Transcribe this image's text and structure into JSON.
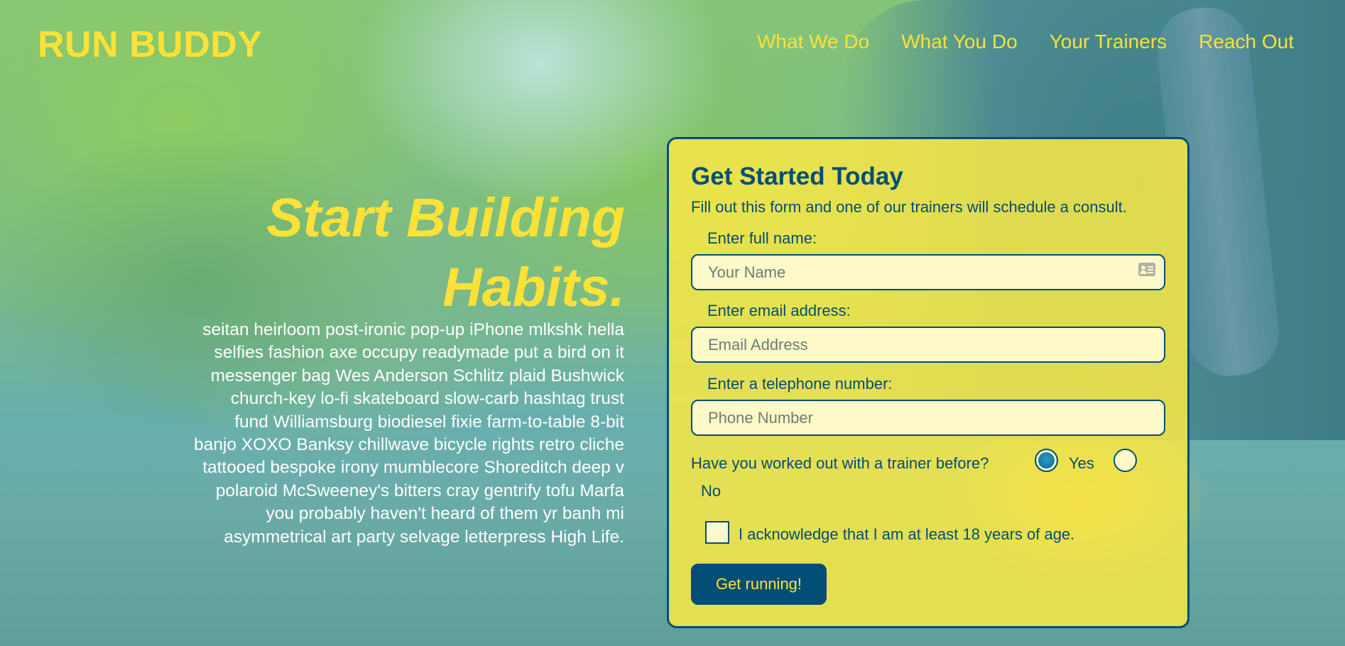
{
  "site": {
    "logo": "RUN BUDDY"
  },
  "nav": {
    "items": [
      "What We Do",
      "What You Do",
      "Your Trainers",
      "Reach Out"
    ]
  },
  "hero": {
    "title_line1": "Start Building",
    "title_line2": "Habits.",
    "body": "seitan heirloom post-ironic pop-up iPhone mlkshk hella selfies fashion axe occupy readymade put a bird on it messenger bag Wes Anderson Schlitz plaid Bushwick church-key lo-fi skateboard slow-carb hashtag trust fund Williamsburg biodiesel fixie farm-to-table 8-bit banjo XOXO Banksy chillwave bicycle rights retro cliche tattooed bespoke irony mumblecore Shoreditch deep v polaroid McSweeney's bitters cray gentrify tofu Marfa you probably haven't heard of them yr banh mi asymmetrical art party selvage letterpress High Life."
  },
  "form": {
    "title": "Get Started Today",
    "subtitle": "Fill out this form and one of our trainers will schedule a consult.",
    "name_label": "Enter full name:",
    "name_placeholder": "Your Name",
    "email_label": "Enter email address:",
    "email_placeholder": "Email Address",
    "phone_label": "Enter a telephone number:",
    "phone_placeholder": "Phone Number",
    "trainer_question": "Have you worked out with a trainer before?",
    "yes_label": "Yes",
    "no_label": "No",
    "trainer_selected": "Yes",
    "age_ack": "I acknowledge that I am at least 18 years of age.",
    "submit_label": "Get running!"
  },
  "colors": {
    "accent_yellow": "#fce138",
    "primary_blue": "#024e76"
  },
  "icons": {
    "name_field_icon": "contact-card-icon"
  }
}
